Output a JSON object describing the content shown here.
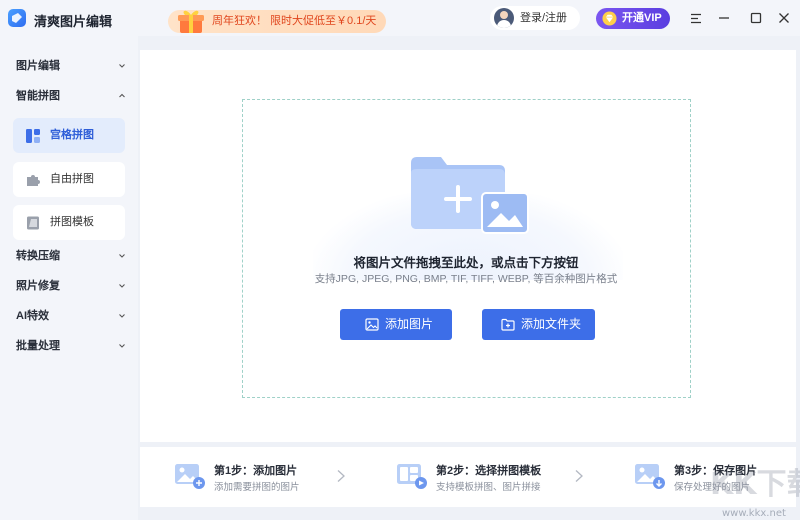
{
  "app": {
    "title": "清爽图片编辑"
  },
  "promo": {
    "text": "周年狂欢！ 限时大促低至￥0.1/天"
  },
  "header": {
    "login_label": "登录/注册",
    "vip_label": "开通VIP"
  },
  "sidebar": {
    "groups": [
      {
        "label": "图片编辑"
      },
      {
        "label": "智能拼图"
      },
      {
        "label": "转换压缩"
      },
      {
        "label": "照片修复"
      },
      {
        "label": "AI特效"
      },
      {
        "label": "批量处理"
      }
    ],
    "sub_items": [
      {
        "label": "宫格拼图",
        "icon": "grid-collage-icon",
        "active": true
      },
      {
        "label": "自由拼图",
        "icon": "puzzle-piece-icon",
        "active": false
      },
      {
        "label": "拼图模板",
        "icon": "template-icon",
        "active": false
      }
    ]
  },
  "dropzone": {
    "title": "将图片文件拖拽至此处，或点击下方按钮",
    "subtitle": "支持JPG, JPEG, PNG, BMP, TIF, TIFF, WEBP, 等百余种图片格式",
    "add_image_label": "添加图片",
    "add_folder_label": "添加文件夹"
  },
  "steps": [
    {
      "title": "第1步：添加图片",
      "desc": "添加需要拼图的图片"
    },
    {
      "title": "第2步：选择拼图模板",
      "desc": "支持模板拼图、图片拼接"
    },
    {
      "title": "第3步：保存图片",
      "desc": "保存处理好的图片"
    }
  ],
  "watermark": {
    "text": "www.kkx.net"
  },
  "colors": {
    "accent": "#3d6ee8",
    "vip": "#6a48e8",
    "promo_text": "#e0461d",
    "active_bg": "#e3ecfc"
  }
}
